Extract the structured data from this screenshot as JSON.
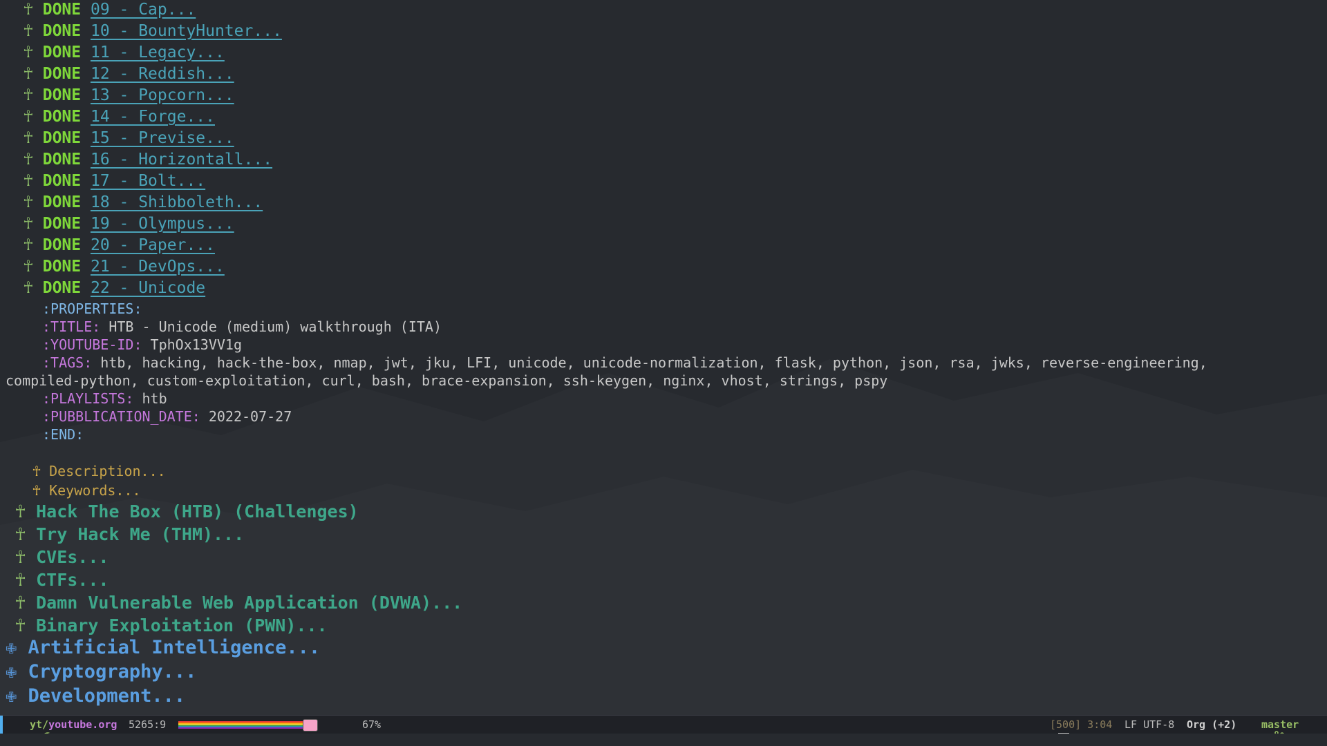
{
  "outline": {
    "done_items": [
      {
        "state": "DONE",
        "title": "09 - Cap..."
      },
      {
        "state": "DONE",
        "title": "10 - BountyHunter..."
      },
      {
        "state": "DONE",
        "title": "11 - Legacy..."
      },
      {
        "state": "DONE",
        "title": "12 - Reddish..."
      },
      {
        "state": "DONE",
        "title": "13 - Popcorn..."
      },
      {
        "state": "DONE",
        "title": "14 - Forge..."
      },
      {
        "state": "DONE",
        "title": "15 - Previse..."
      },
      {
        "state": "DONE",
        "title": "16 - Horizontall..."
      },
      {
        "state": "DONE",
        "title": "17 - Bolt..."
      },
      {
        "state": "DONE",
        "title": "18 - Shibboleth..."
      },
      {
        "state": "DONE",
        "title": "19 - Olympus..."
      },
      {
        "state": "DONE",
        "title": "20 - Paper..."
      },
      {
        "state": "DONE",
        "title": "21 - DevOps..."
      },
      {
        "state": "DONE",
        "title": "22 - Unicode"
      }
    ],
    "drawer": {
      "start": ":PROPERTIES:",
      "end": ":END:",
      "props": [
        {
          "key": ":TITLE:",
          "value": "HTB - Unicode (medium) walkthrough (ITA)"
        },
        {
          "key": ":YOUTUBE-ID:",
          "value": "TphOx13VV1g"
        },
        {
          "key": ":TAGS:",
          "value": "htb, hacking, hack-the-box, nmap, jwt, jku, LFI, unicode, unicode-normalization, flask, python, json, rsa, jwks, reverse-engineering,",
          "continuation": "compiled-python, custom-exploitation, curl, bash, brace-expansion, ssh-keygen, nginx, vhost, strings, pspy"
        },
        {
          "key": ":PLAYLISTS:",
          "value": "htb"
        },
        {
          "key": ":PUBBLICATION_DATE:",
          "value": "2022-07-27"
        }
      ]
    },
    "subheadings": [
      "Description...",
      "Keywords..."
    ],
    "level2": [
      "Hack The Box (HTB) (Challenges)",
      "Try Hack Me (THM)...",
      "CVEs...",
      "CTFs...",
      "Damn Vulnerable Web Application (DVWA)...",
      "Binary Exploitation (PWN)..."
    ],
    "level1": [
      "Artificial Intelligence...",
      "Cryptography...",
      "Development..."
    ],
    "bullet_symbol": "☥",
    "l1_bullet_symbol": "✙"
  },
  "modeline": {
    "dir": "yt/",
    "file": "youtube.org",
    "position": "5265:9",
    "percent": "67%",
    "mail_icon": "envelope-icon",
    "count_time": "[500] 3:04",
    "encoding": "LF UTF-8",
    "mode": "Org (+2)",
    "branch_icon": "git-branch-icon",
    "branch": "master"
  },
  "colors": {
    "background": "#272a2f",
    "done": "#7fd83a",
    "link": "#4aa3b8",
    "level2": "#3ea78a",
    "level1": "#5a9ee0",
    "property_key": "#c678dd"
  }
}
